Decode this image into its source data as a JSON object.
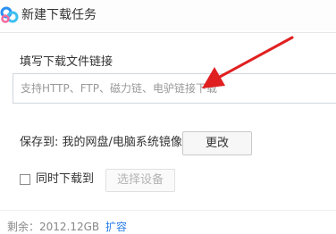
{
  "window": {
    "title": "新建下载任务",
    "logo_icon": "baidu-netdisk-cloud-logo"
  },
  "link_section": {
    "label": "填写下载文件链接",
    "placeholder": "支持HTTP、FTP、磁力链、电驴链接下载"
  },
  "save_section": {
    "label": "保存到: 我的网盘/电脑系统镜像",
    "change_button": "更改"
  },
  "simultaneous": {
    "label": "同时下载到",
    "checked": false,
    "device_button": "选择设备"
  },
  "footer": {
    "space_text": "剩余：2012.12GB",
    "expand_link": "扩容"
  },
  "colors": {
    "link": "#2a7ee8",
    "annotation_arrow": "#e02020"
  }
}
